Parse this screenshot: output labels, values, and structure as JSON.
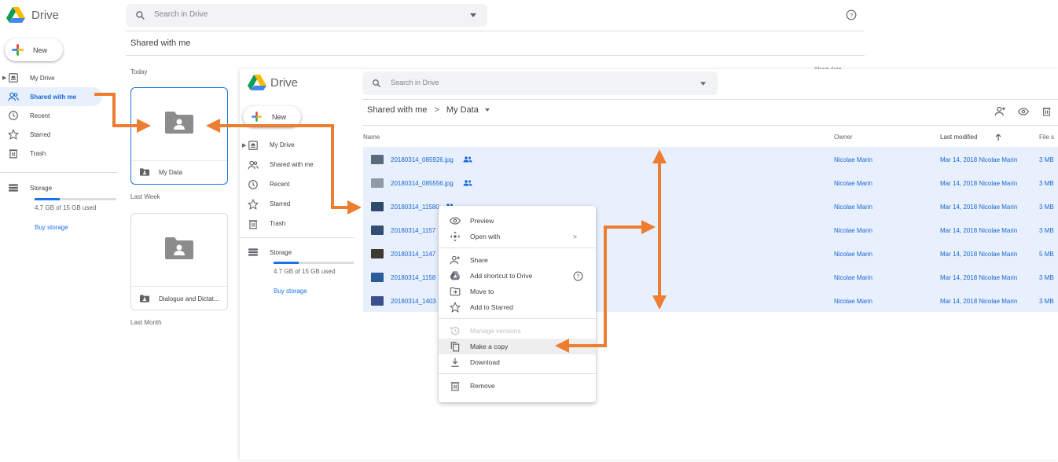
{
  "back": {
    "app_name": "Drive",
    "search_placeholder": "Search in Drive",
    "new_label": "New",
    "page_title": "Shared with me",
    "sort_label": "Share date",
    "nav": [
      {
        "label": "My Drive",
        "icon": "my-drive-icon"
      },
      {
        "label": "Shared with me",
        "icon": "shared-icon",
        "active": true
      },
      {
        "label": "Recent",
        "icon": "clock-icon"
      },
      {
        "label": "Starred",
        "icon": "star-icon"
      },
      {
        "label": "Trash",
        "icon": "trash-icon"
      }
    ],
    "storage": {
      "label": "Storage",
      "used_text": "4.7 GB of 15 GB used",
      "used_fraction": 0.31,
      "buy_label": "Buy storage"
    },
    "sections": {
      "today": "Today",
      "last_week": "Last Week",
      "last_month": "Last Month"
    },
    "cards": [
      {
        "name": "My Data"
      },
      {
        "name": "Dialogue and Dictat..."
      }
    ]
  },
  "front": {
    "app_name": "Drive",
    "search_placeholder": "Search in Drive",
    "new_label": "New",
    "breadcrumb": {
      "parent": "Shared with me",
      "separator": ">",
      "current": "My Data"
    },
    "nav": [
      {
        "label": "My Drive",
        "icon": "my-drive-icon"
      },
      {
        "label": "Shared with me",
        "icon": "shared-icon"
      },
      {
        "label": "Recent",
        "icon": "clock-icon"
      },
      {
        "label": "Starred",
        "icon": "star-icon"
      },
      {
        "label": "Trash",
        "icon": "trash-icon"
      }
    ],
    "storage": {
      "label": "Storage",
      "used_text": "4.7 GB of 15 GB used",
      "used_fraction": 0.31,
      "buy_label": "Buy storage"
    },
    "columns": {
      "name": "Name",
      "owner": "Owner",
      "modified": "Last modified",
      "size": "File s"
    },
    "files": [
      {
        "name": "20180314_085926.jpg",
        "shared": true,
        "owner": "Nicolae Marin",
        "modified": "Mar 14, 2018 Nicolae Marin",
        "size": "3 MB"
      },
      {
        "name": "20180314_085556.jpg",
        "shared": true,
        "owner": "Nicolae Marin",
        "modified": "Mar 14, 2018 Nicolae Marin",
        "size": "3 MB"
      },
      {
        "name": "20180314_11580",
        "shared": true,
        "owner": "Nicolae Marin",
        "modified": "Mar 14, 2018 Nicolae Marin",
        "size": "3 MB"
      },
      {
        "name": "20180314_1157",
        "shared": false,
        "owner": "Nicolae Marin",
        "modified": "Mar 14, 2018 Nicolae Marin",
        "size": "3 MB"
      },
      {
        "name": "20180314_1147",
        "shared": false,
        "owner": "Nicolae Marin",
        "modified": "Mar 14, 2018 Nicolae Marin",
        "size": "5 MB"
      },
      {
        "name": "20180314_1158",
        "shared": false,
        "owner": "Nicolae Marin",
        "modified": "Mar 14, 2018 Nicolae Marin",
        "size": "3 MB"
      },
      {
        "name": "20180314_1403",
        "shared": false,
        "owner": "Nicolae Marin",
        "modified": "Mar 14, 2018 Nicolae Marin",
        "size": "3 MB"
      }
    ]
  },
  "context_menu": {
    "items": [
      {
        "label": "Preview",
        "icon": "eye-icon"
      },
      {
        "label": "Open with",
        "icon": "move-arrows-icon",
        "submenu": ">"
      },
      {
        "label": "Share",
        "icon": "add-person-icon"
      },
      {
        "label": "Add shortcut to Drive",
        "icon": "shortcut-icon"
      },
      {
        "label": "Move to",
        "icon": "move-to-icon"
      },
      {
        "label": "Add to Starred",
        "icon": "star-icon"
      },
      {
        "label": "Manage versions",
        "icon": "history-icon",
        "disabled": true
      },
      {
        "label": "Make a copy",
        "icon": "copy-icon",
        "highlighted": true
      },
      {
        "label": "Download",
        "icon": "download-icon"
      },
      {
        "label": "Remove",
        "icon": "trash-icon"
      }
    ]
  },
  "colors": {
    "accent": "#1a73e8",
    "selection": "#e8f0fe",
    "annotation_arrow": "#ed7d31"
  }
}
